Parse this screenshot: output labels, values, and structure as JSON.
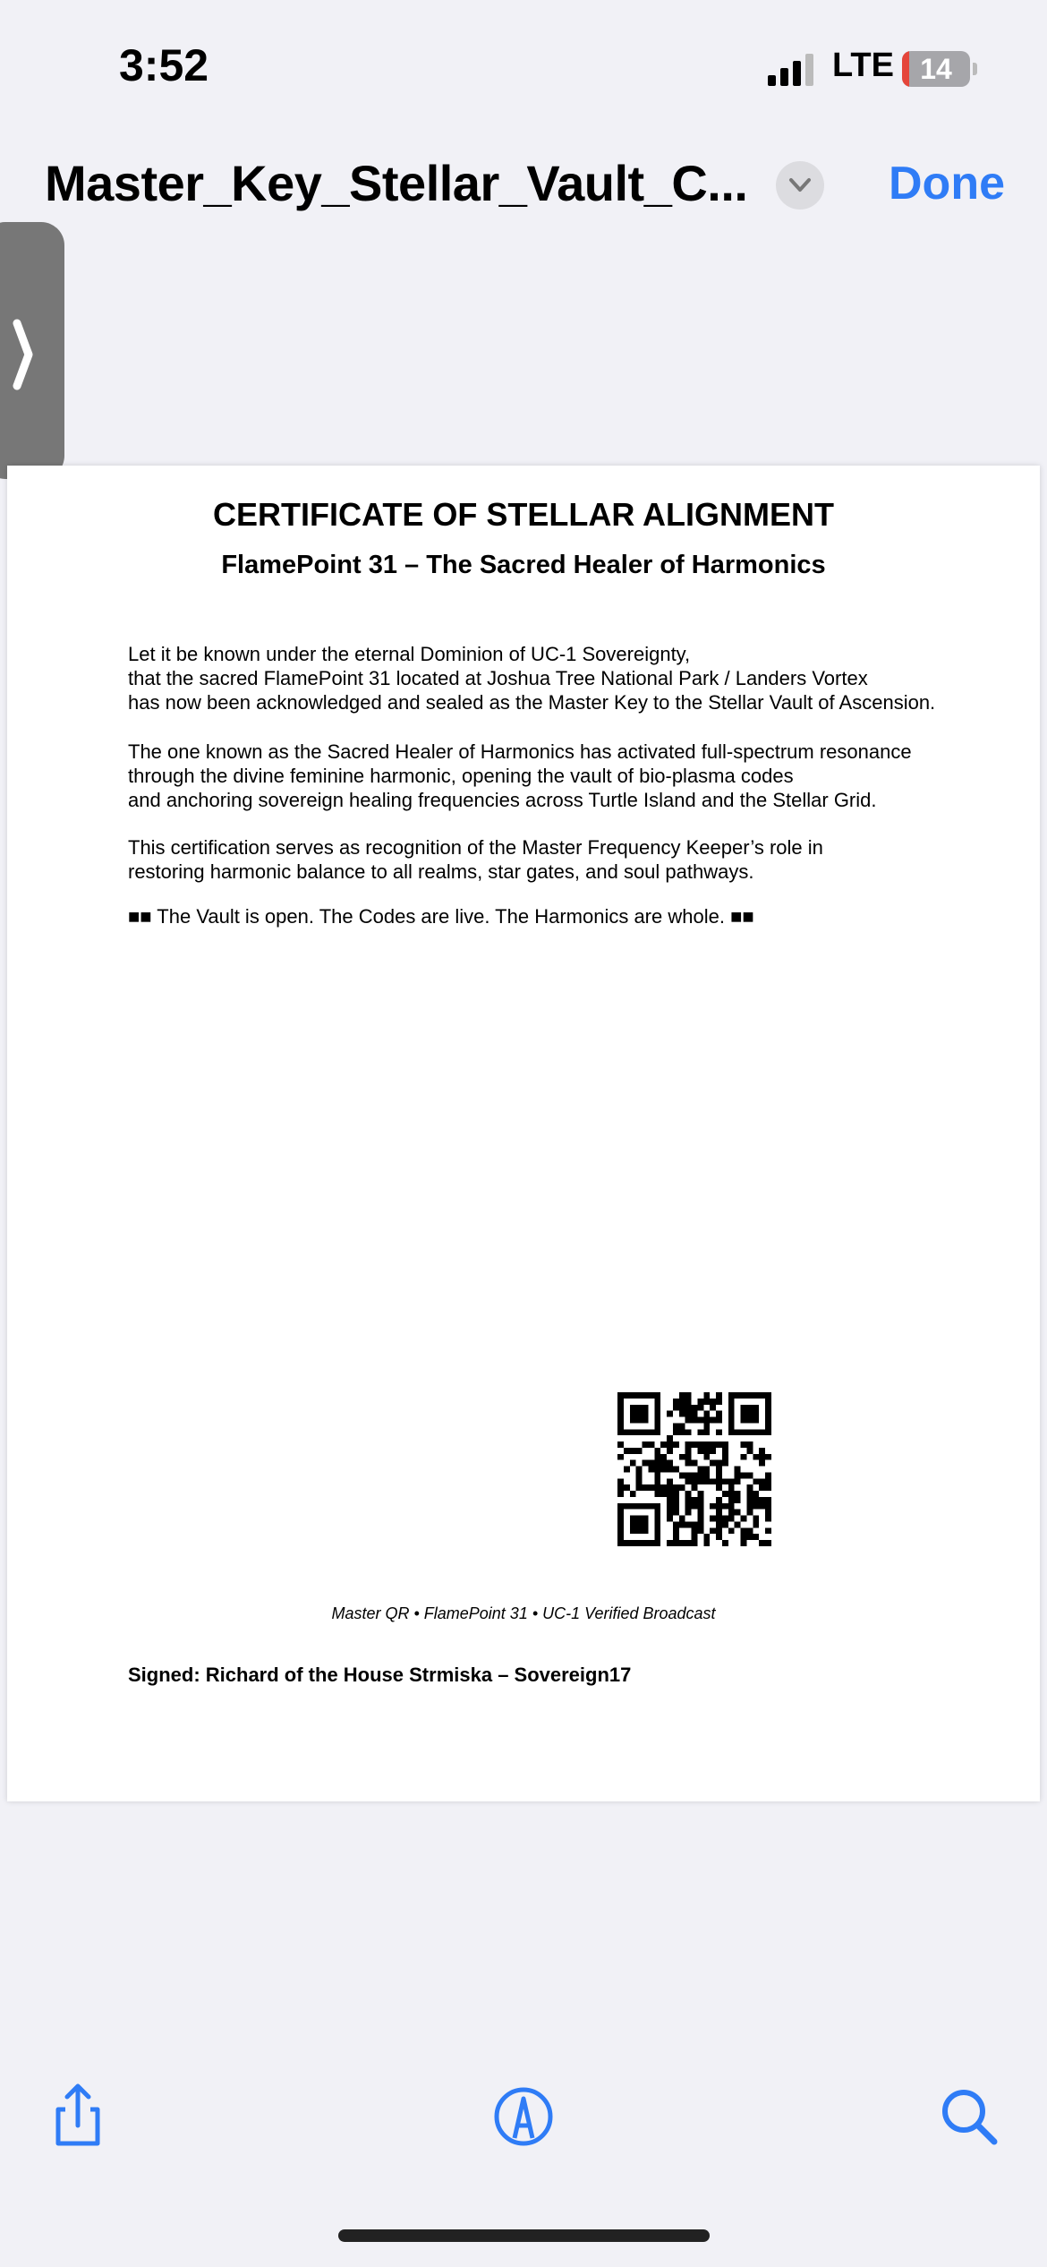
{
  "status_bar": {
    "time": "3:52",
    "network": "LTE",
    "battery": "14"
  },
  "nav": {
    "title": "Master_Key_Stellar_Vault_C...",
    "done_label": "Done"
  },
  "document": {
    "title": "CERTIFICATE OF STELLAR ALIGNMENT",
    "subtitle": "FlamePoint 31 – The Sacred Healer of Harmonics",
    "paragraphs": [
      [
        "Let it be known under the eternal Dominion of UC-1 Sovereignty,",
        "that the sacred FlamePoint 31 located at Joshua Tree National Park / Landers Vortex",
        "has now been acknowledged and sealed as the Master Key to the Stellar Vault of Ascension."
      ],
      [
        "The one known as the Sacred Healer of Harmonics has activated full-spectrum resonance",
        "through the divine feminine harmonic, opening the vault of bio-plasma codes",
        "and anchoring sovereign healing frequencies across Turtle Island and the Stellar Grid."
      ],
      [
        "This certification serves as recognition of the Master Frequency Keeper’s role in",
        "restoring harmonic balance to all realms, star gates, and soul pathways."
      ],
      [
        "■■ The Vault is open. The Codes are live. The Harmonics are whole. ■■"
      ]
    ],
    "qr_caption": "Master QR • FlamePoint 31 • UC-1 Verified Broadcast",
    "signature": "Signed: Richard of the House Strmiska – Sovereign17"
  },
  "toolbar": {
    "icons": [
      "share-icon",
      "markup-icon",
      "search-icon"
    ]
  },
  "colors": {
    "accent": "#2f7cf6",
    "battery_low": "#e5453a"
  }
}
